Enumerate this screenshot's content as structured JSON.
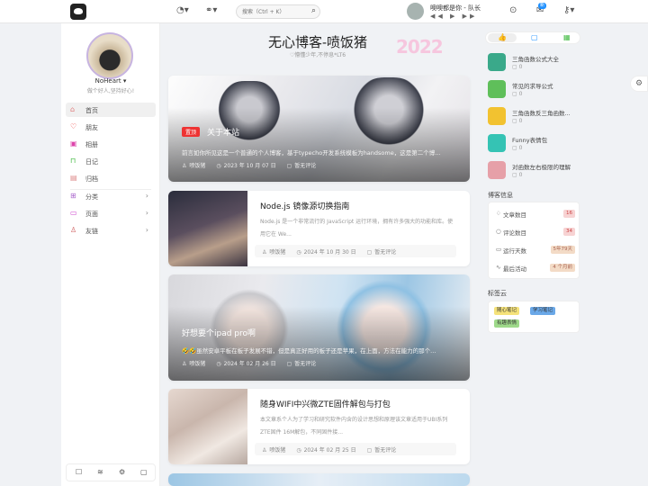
{
  "topbar": {
    "search_placeholder": "搜索（Ctrl + K）",
    "player_title": "噢噢都是你 - 队长",
    "player_controls": "◀◀ ▶ ▶▶",
    "notify_count": "新"
  },
  "profile": {
    "name": "NoHeart ▾",
    "motto": "做个好人,坚持好心!"
  },
  "nav": [
    {
      "label": "首页",
      "icon": "home-icon"
    },
    {
      "label": "朋友",
      "icon": "heart-icon"
    },
    {
      "label": "相册",
      "icon": "image-icon"
    },
    {
      "label": "日记",
      "icon": "lock-icon"
    },
    {
      "label": "归档",
      "icon": "archive-icon"
    },
    {
      "label": "分类",
      "icon": "grid-icon",
      "arrow": "›"
    },
    {
      "label": "页面",
      "icon": "page-icon",
      "arrow": "›"
    },
    {
      "label": "友链",
      "icon": "user-icon",
      "arrow": "›"
    }
  ],
  "site": {
    "title": "无心博客-喷饭猪",
    "subtitle": "♡懵懂少年,不停息*LT6",
    "deco": "2022"
  },
  "posts": [
    {
      "tag": "置顶",
      "title": "关于本站",
      "excerpt": "前言如你所见这是一个普通的个人博客，基于typecho开发系统模板为handsome，这是第二个博...",
      "author": "喷饭猪",
      "date": "2023 年 10 月 07 日",
      "comments": "暂无评论"
    },
    {
      "title": "Node.js 镜像源切换指南",
      "excerpt": "Node.js 是一个非常流行的 JavaScript 运行环境，拥有许多强大的功能和库。使用它在 We...",
      "author": "喷饭猪",
      "date": "2024 年 10 月 30 日",
      "comments": "暂无评论"
    },
    {
      "title": "好想要个ipad pro啊",
      "excerpt": "🤣🤣虽然安卓平板在板子发展不错，但是真正好用的板子还是苹果，在上面，方法在能力的那个...",
      "author": "喷饭猪",
      "date": "2024 年 02 月 26 日",
      "comments": "暂无评论"
    },
    {
      "title": "随身WIFI中兴微ZTE固件解包与打包",
      "excerpt": "本文章系个人为了学习和研究软件内含的设计思想和原理该文章适用于UBI系列 ZTE固件 16M解包，不同固件接...",
      "author": "喷饭猪",
      "date": "2024 年 02 月 25 日",
      "comments": "暂无评论"
    }
  ],
  "hot": [
    {
      "title": "三角函数公式大全",
      "count": "0",
      "color": "#3aa98a"
    },
    {
      "title": "常见的求导公式",
      "count": "0",
      "color": "#5fbf5a"
    },
    {
      "title": "三角函数反三角函数...",
      "count": "0",
      "color": "#f2c230"
    },
    {
      "title": "Funny表情包",
      "count": "0",
      "color": "#35c3b4"
    },
    {
      "title": "对函数左右极限的理解",
      "count": "0",
      "color": "#e6a0a8"
    }
  ],
  "info": {
    "title": "博客信息",
    "rows": [
      {
        "label": "文章数目",
        "value": "16",
        "icon": "doc-icon",
        "bg": "#f7d3d3",
        "fg": "#c44"
      },
      {
        "label": "评论数目",
        "value": "34",
        "icon": "comment-icon",
        "bg": "#f7d3d3",
        "fg": "#c44"
      },
      {
        "label": "运行天数",
        "value": "5年79天",
        "icon": "calendar-icon",
        "bg": "#f3dbc6",
        "fg": "#a65"
      },
      {
        "label": "最后活动",
        "value": "4 个月前",
        "icon": "pulse-icon",
        "bg": "#f3dbc6",
        "fg": "#a65"
      }
    ]
  },
  "tags": {
    "title": "标签云",
    "items": [
      {
        "label": "随心笔记",
        "bg": "#f5e27a"
      },
      {
        "label": "学习笔记",
        "bg": "#6aa8e8"
      },
      {
        "label": "有趣表情",
        "bg": "#9ed98a"
      }
    ]
  }
}
